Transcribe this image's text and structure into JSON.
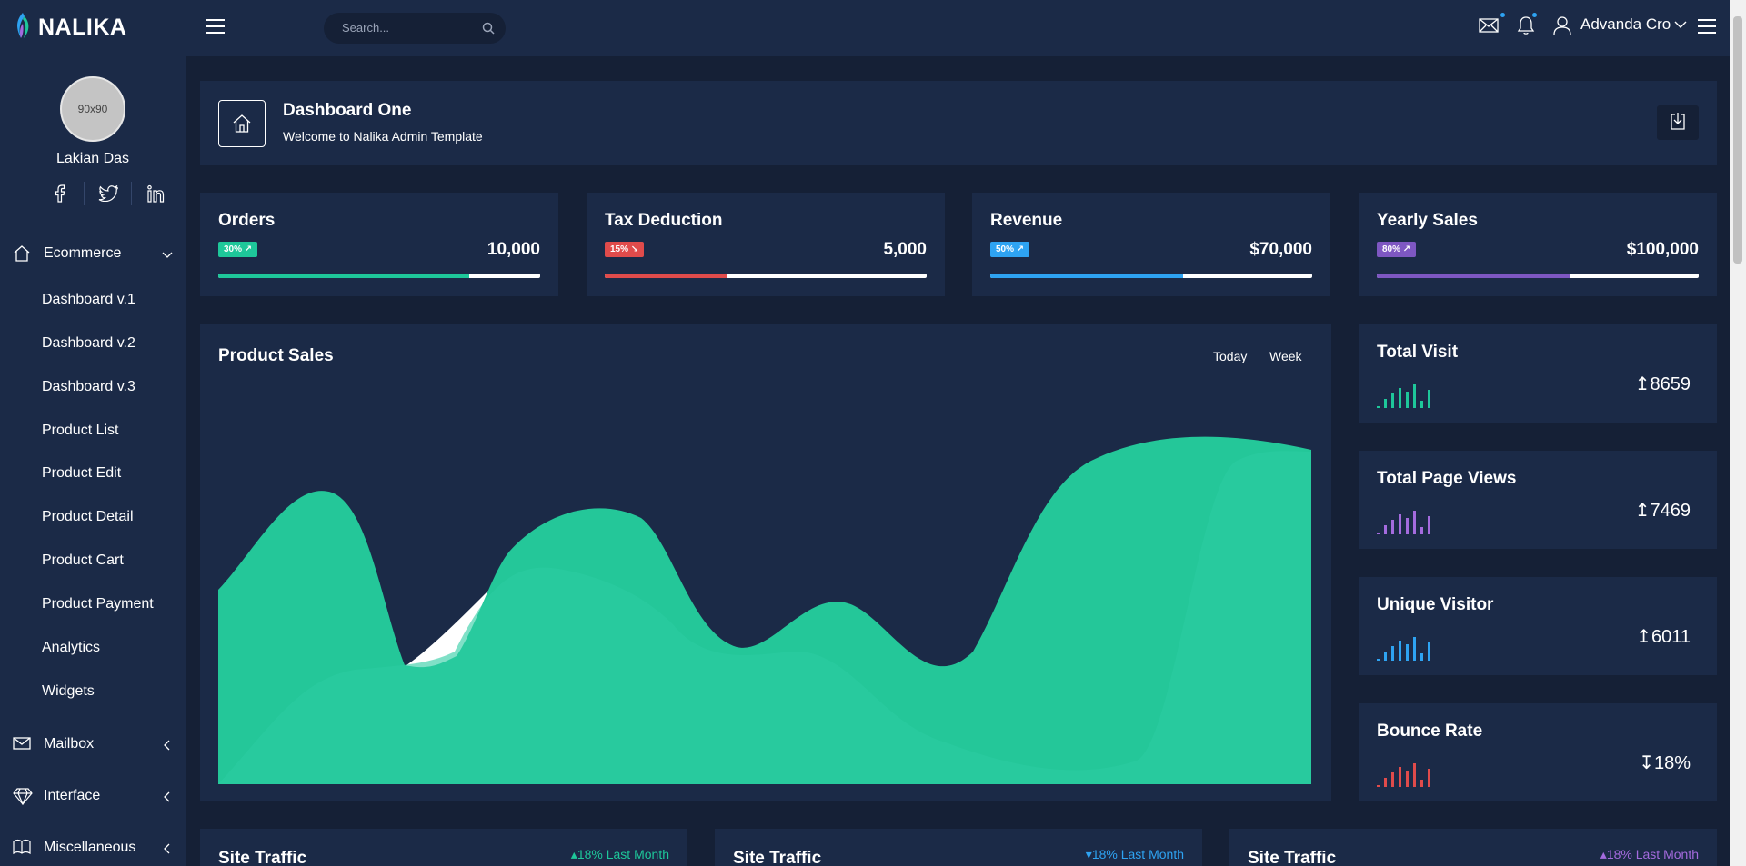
{
  "brand": {
    "name": "NALIKA"
  },
  "profile": {
    "avatar_text": "90x90",
    "name": "Lakian Das"
  },
  "sidebar": {
    "ecommerce_label": "Ecommerce",
    "ecommerce_items": [
      "Dashboard v.1",
      "Dashboard v.2",
      "Dashboard v.3",
      "Product List",
      "Product Edit",
      "Product Detail",
      "Product Cart",
      "Product Payment",
      "Analytics",
      "Widgets"
    ],
    "mailbox_label": "Mailbox",
    "interface_label": "Interface",
    "misc_label": "Miscellaneous"
  },
  "topbar": {
    "search_placeholder": "Search...",
    "user_name": "Advanda Cro"
  },
  "page_header": {
    "title": "Dashboard One",
    "subtitle": "Welcome to Nalika Admin Template"
  },
  "stats": [
    {
      "title": "Orders",
      "badge": "30%",
      "direction": "up",
      "value": "10,000",
      "progress": 0.78,
      "color": "#1ec79a"
    },
    {
      "title": "Tax Deduction",
      "badge": "15%",
      "direction": "down",
      "value": "5,000",
      "progress": 0.38,
      "color": "#e04b4b"
    },
    {
      "title": "Revenue",
      "badge": "50%",
      "direction": "up",
      "value": "$70,000",
      "progress": 0.6,
      "color": "#2ea3f2"
    },
    {
      "title": "Yearly Sales",
      "badge": "80%",
      "direction": "up",
      "value": "$100,000",
      "progress": 0.6,
      "color": "#7e57c2"
    }
  ],
  "product_sales": {
    "title": "Product Sales",
    "tabs": [
      "Today",
      "Week"
    ]
  },
  "mini_stats": [
    {
      "title": "Total Visit",
      "value": "8659",
      "direction": "up",
      "color": "#1ec79a"
    },
    {
      "title": "Total Page Views",
      "value": "7469",
      "direction": "up",
      "color": "#a46bde"
    },
    {
      "title": "Unique Visitor",
      "value": "6011",
      "direction": "up",
      "color": "#2ea3f2"
    },
    {
      "title": "Bounce Rate",
      "value": "18%",
      "direction": "down",
      "color": "#e04b4b"
    }
  ],
  "traffic": [
    {
      "title": "Site Traffic",
      "stat": "18% Last Month",
      "direction": "up",
      "color": "#1ec79a"
    },
    {
      "title": "Site Traffic",
      "stat": "18% Last Month",
      "direction": "down",
      "color": "#2ea3f2"
    },
    {
      "title": "Site Traffic",
      "stat": "18% Last Month",
      "direction": "up",
      "color": "#a46bde"
    }
  ]
}
